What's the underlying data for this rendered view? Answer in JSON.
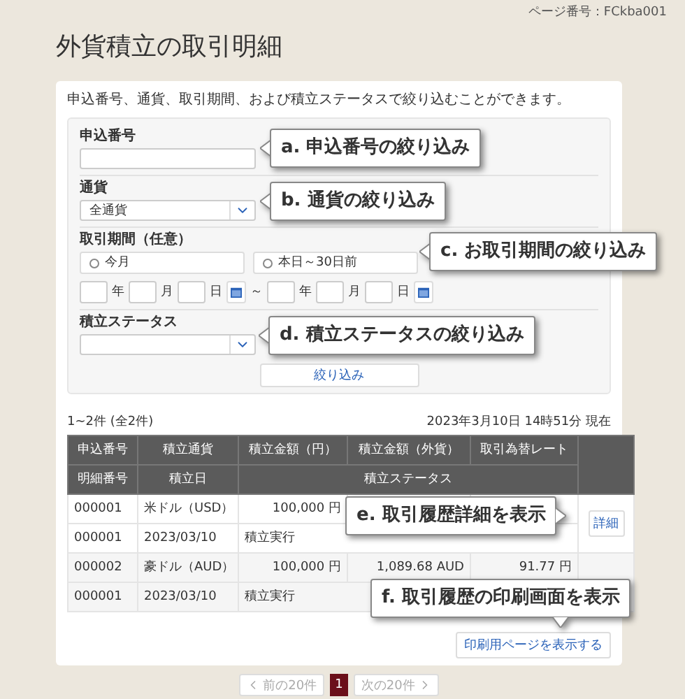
{
  "page_number": "ページ番号：FCkba001",
  "title": "外貨積立の取引明細",
  "filter": {
    "description": "申込番号、通貨、取引期間、および積立ステータスで絞り込むことができます。",
    "fields": [
      {
        "kind": "text",
        "label": "申込番号"
      },
      {
        "kind": "select",
        "label": "通貨",
        "value": "全通貨"
      },
      {
        "kind": "period",
        "label": "取引期間（任意）",
        "options": [
          {
            "label": "今月",
            "selected": false
          },
          {
            "label": "本日～30日前",
            "selected": false
          }
        ],
        "from_units": [
          "年",
          "月",
          "日"
        ],
        "separator": "～",
        "to_units": [
          "年",
          "月",
          "日"
        ]
      },
      {
        "kind": "select",
        "label": "積立ステータス"
      }
    ],
    "submit": "絞り込み"
  },
  "results": {
    "count": "1~2件 (全2件)",
    "timestamp": "2023年3月10日 14時51分 現在",
    "header_top": [
      "申込番号",
      "積立通貨",
      "積立金額（円）",
      "積立金額（外貨）",
      "取引為替レート"
    ],
    "header_bottom": [
      "明細番号",
      "積立日",
      "積立ステータス"
    ],
    "records": [
      {
        "apply_no": "000001",
        "currency": "米ドル（USD）",
        "amount_yen": "100,000 円",
        "detail_no": "000001",
        "date": "2023/03/10",
        "status": "積立実行",
        "detail": "詳細"
      },
      {
        "apply_no": "000002",
        "currency": "豪ドル（AUD）",
        "amount_yen": "100,000 円",
        "amount_fx": "1,089.68 AUD",
        "rate": "91.77 円",
        "detail_no": "000001",
        "date": "2023/03/10",
        "status": "積立実行"
      }
    ],
    "print_button": "印刷用ページを表示する"
  },
  "pagination": {
    "prev": "前の20件",
    "pages": [
      {
        "label": "1",
        "selected": true
      }
    ],
    "next": "次の20件"
  },
  "callouts": [
    "a. 申込番号の絞り込み",
    "b. 通貨の絞り込み",
    "c. お取引期間の絞り込み",
    "d. 積立ステータスの絞り込み",
    "e. 取引履歴詳細を表示",
    "f. 取引履歴の印刷画面を表示"
  ]
}
